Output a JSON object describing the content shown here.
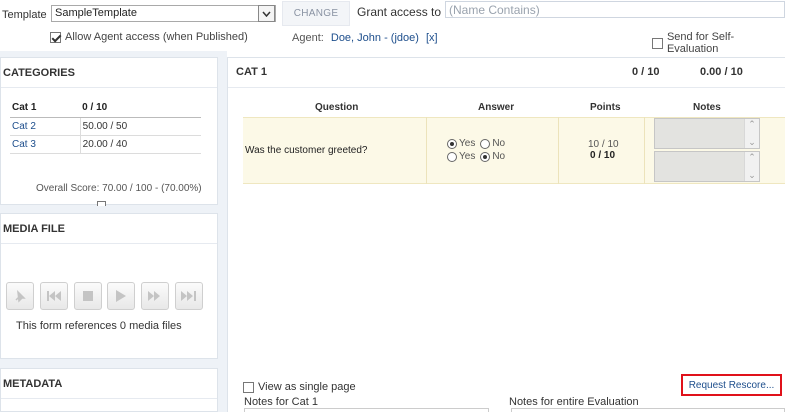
{
  "header": {
    "template_label": "Template",
    "template_value": "SampleTemplate",
    "change_label": "CHANGE",
    "grant_label": "Grant access to",
    "grant_placeholder": "(Name Contains)",
    "allow_agent_label": "Allow Agent access (when Published)",
    "allow_agent_checked": true,
    "agent_label": "Agent:",
    "agent_value": "Doe, John - (jdoe)",
    "agent_link": "[x]",
    "self_eval_label": "Send for Self-Evaluation",
    "self_eval_checked": false
  },
  "categories": {
    "title": "CATEGORIES",
    "rows": [
      {
        "name": "Cat 1",
        "score": "0 / 10",
        "header": true
      },
      {
        "name": "Cat 2",
        "score": "50.00 / 50"
      },
      {
        "name": "Cat 3",
        "score": "20.00 / 40"
      }
    ],
    "overall": "Overall Score: 70.00 / 100 - (70.00%)"
  },
  "media": {
    "title": "MEDIA FILE",
    "buttons": [
      "pin-icon",
      "skip-back-icon",
      "stop-icon",
      "play-icon",
      "fast-forward-icon",
      "skip-end-icon"
    ],
    "message": "This form references 0 media files"
  },
  "metadata": {
    "title": "METADATA"
  },
  "main": {
    "title": "CAT 1",
    "score": "0 / 10",
    "points": "0.00 / 10",
    "columns": {
      "question": "Question",
      "answer": "Answer",
      "points": "Points",
      "notes": "Notes"
    },
    "question": "Was the customer greeted?",
    "answer_yes": "Yes",
    "answer_no": "No",
    "answer_row1_selected": "Yes",
    "answer_row2_selected": "No",
    "points_line1": "10 / 10",
    "points_line2": "0 / 10",
    "single_page_label": "View as single page",
    "request_rescore": "Request Rescore...",
    "notes_cat_label": "Notes for Cat 1",
    "notes_eval_label": "Notes for entire Evaluation"
  },
  "colors": {
    "link": "#1d4e8c",
    "highlight_row": "#fcf9e7",
    "rescore_border": "#e0111a",
    "left_background": "#eef2f7"
  }
}
